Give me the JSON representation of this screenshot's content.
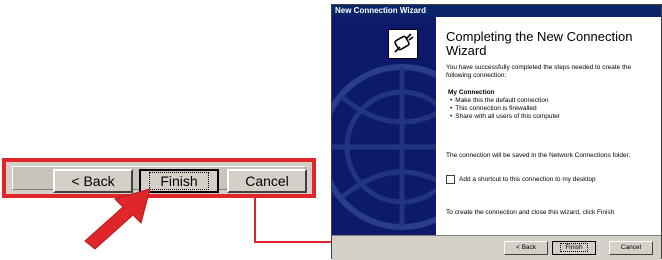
{
  "zoomed_buttons": {
    "back_label": "< Back",
    "finish_label": "Finish",
    "cancel_label": "Cancel"
  },
  "wizard": {
    "window_title": "New Connection Wizard",
    "heading": "Completing the New Connection Wizard",
    "intro": "You have successfully completed the steps needed to create the following connection:",
    "connection_name": "My Connection",
    "details": [
      "Make this the default connection",
      "This connection is firewalled",
      "Share with all users of this computer"
    ],
    "saved_note": "The connection will be saved in the Network Connections folder.",
    "shortcut_label": "Add a shortcut to this connection to my desktop",
    "shortcut_checked": false,
    "closing_note": "To create the connection and close this wizard, click Finish",
    "buttons": {
      "back_label": "< Back",
      "finish_label": "Finish",
      "cancel_label": "Cancel"
    }
  },
  "colors": {
    "highlight": "#e0262b",
    "titlebar": "#0a246a",
    "side_panel": "#0d1a6b",
    "dialog_face": "#d4d0c8"
  },
  "icons": {
    "wizard_icon": "network-plug-icon",
    "pointer": "red-arrow-icon"
  }
}
